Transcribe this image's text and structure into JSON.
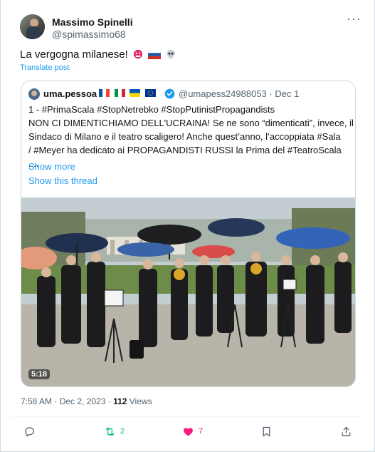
{
  "post": {
    "author_name": "Massimo Spinelli",
    "author_handle": "@spimassimo68",
    "more_icon": "more-horizontal-icon",
    "text": "La vergogna milanese!",
    "text_emojis": [
      "nervous-face-emoji",
      "russia-flag-emoji",
      "skull-emoji"
    ],
    "translate_label": "Translate post",
    "timestamp": "7:58 AM · Dec 2, 2023 · ",
    "views_count": "112",
    "views_label": " Views"
  },
  "quoted": {
    "author_name": "uma.pessoa",
    "flags": [
      "france-flag",
      "italy-flag",
      "ukraine-flag",
      "eu-flag"
    ],
    "verified_icon": "verified-badge-icon",
    "author_handle_date": "@umapess24988053 · Dec 1",
    "lines": [
      "1 - #PrimaScala #StopNetrebko #StopPutinistPropagandists",
      "NON CI DIMENTICHIAMO DELL'UCRAINA! Se ne sono “dimenticati”, invece, il",
      "Sindaco di Milano e il teatro scaligero! Anche quest’anno, l’accoppiata  #Sala",
      "/ #Meyer ha dedicato ai PROPAGANDISTI RUSSI la Prima del #TeatroScala",
      "...."
    ],
    "show_more": "Show more",
    "show_thread": "Show this thread",
    "video_duration": "5:18"
  },
  "actions": {
    "reply_count": "",
    "repost_count": "2",
    "like_count": "7"
  },
  "colors": {
    "link": "#1d9bf0",
    "muted": "#536471",
    "repost": "#00ba7c",
    "like": "#f91880",
    "border": "#cfd9de"
  }
}
